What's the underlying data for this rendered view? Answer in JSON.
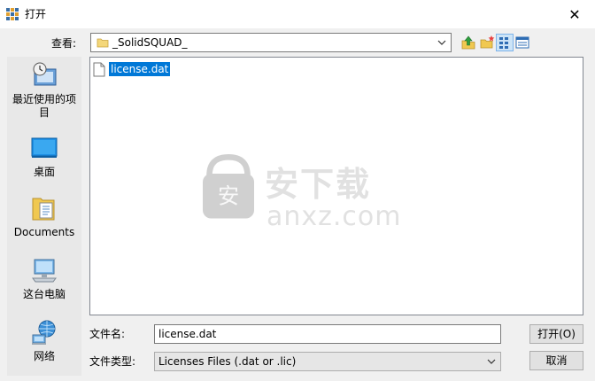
{
  "window": {
    "title": "打开",
    "close_glyph": "✕"
  },
  "toolbar": {
    "lookin_label": "查看:",
    "lookin_value": "_SolidSQUAD_",
    "buttons": [
      "up-folder-icon",
      "new-folder-icon",
      "list-view-icon",
      "details-view-icon"
    ]
  },
  "places": [
    {
      "label": "最近使用的项目",
      "icon": "recent-icon"
    },
    {
      "label": "桌面",
      "icon": "desktop-icon"
    },
    {
      "label": "Documents",
      "icon": "documents-icon"
    },
    {
      "label": "这台电脑",
      "icon": "computer-icon"
    },
    {
      "label": "网络",
      "icon": "network-icon"
    }
  ],
  "files": [
    {
      "name": "license.dat",
      "selected": true
    }
  ],
  "watermark": {
    "cn": "安下载",
    "en": "anxz.com"
  },
  "form": {
    "filename_label": "文件名:",
    "filename_value": "license.dat",
    "filetype_label": "文件类型:",
    "filetype_value": "Licenses Files (.dat or .lic)"
  },
  "buttons": {
    "open": "打开(O)",
    "cancel": "取消"
  },
  "colors": {
    "selection": "#0078d7",
    "window_bg": "#f0f0f0",
    "places_bg": "#e8e8e8"
  }
}
